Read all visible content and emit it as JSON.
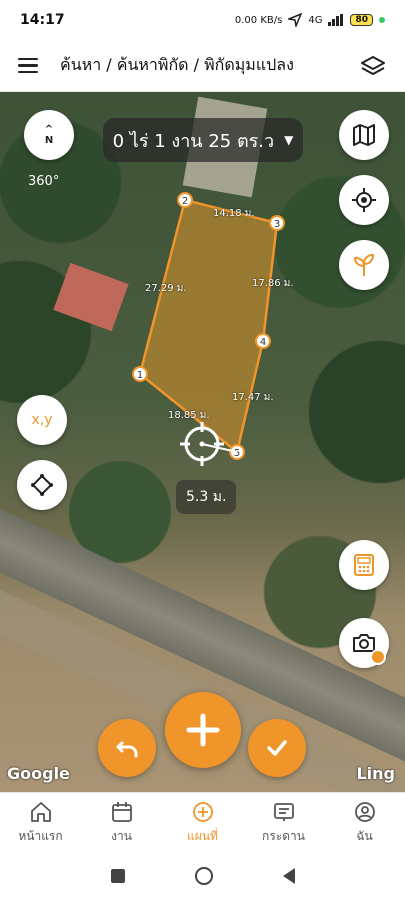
{
  "status_bar": {
    "time": "14:17",
    "net_speed": "0.00 KB/s",
    "network": "4G",
    "battery": "80"
  },
  "app_bar": {
    "title": "ค้นหา / ค้นหาพิกัด / พิกัดมุมแปลง",
    "menu_icon": "hamburger-icon",
    "layers_icon": "layers-icon"
  },
  "map": {
    "area_text": "0 ไร่ 1 งาน 25 ตร.ว",
    "compass_letter": "N",
    "rotation_label": "360°",
    "xy_label": "x,y",
    "measure_distance": "5.3 ม.",
    "vertices": [
      "1",
      "2",
      "3",
      "4",
      "5"
    ],
    "segments": [
      "14.18 ม.",
      "17.86 ม.",
      "27.29 ม.",
      "17.47 ม.",
      "18.85 ม."
    ],
    "attribution_left": "Google",
    "attribution_right": "Ling"
  },
  "colors": {
    "accent": "#f0952a",
    "parcel_fill": "#b8862f"
  },
  "bottom_nav": [
    {
      "label": "หน้าแรก",
      "icon": "home-icon"
    },
    {
      "label": "งาน",
      "icon": "calendar-icon"
    },
    {
      "label": "แผนที่",
      "icon": "map-add-icon"
    },
    {
      "label": "กระดาน",
      "icon": "board-icon"
    },
    {
      "label": "ฉัน",
      "icon": "profile-icon"
    }
  ]
}
